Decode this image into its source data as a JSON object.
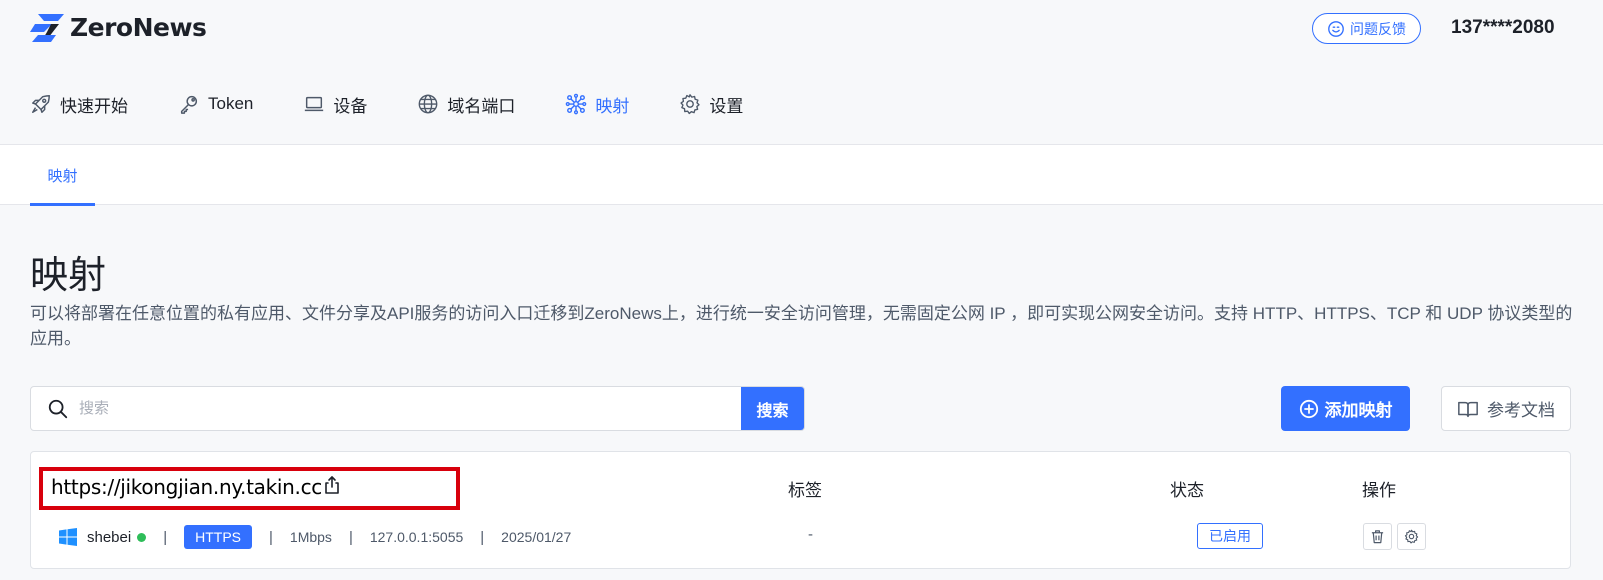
{
  "header": {
    "brand": "ZeroNews",
    "feedback_label": "问题反馈",
    "user_phone": "137****2080"
  },
  "nav": {
    "items": [
      {
        "label": "快速开始",
        "icon": "rocket-icon"
      },
      {
        "label": "Token",
        "icon": "key-icon"
      },
      {
        "label": "设备",
        "icon": "laptop-icon"
      },
      {
        "label": "域名端口",
        "icon": "globe-icon"
      },
      {
        "label": "映射",
        "icon": "network-icon",
        "active": true
      },
      {
        "label": "设置",
        "icon": "gear-icon"
      }
    ]
  },
  "subtabs": [
    {
      "label": "映射",
      "active": true
    }
  ],
  "page": {
    "title": "映射",
    "description": "可以将部署在任意位置的私有应用、文件分享及API服务的访问入口迁移到ZeroNews上，进行统一安全访问管理，无需固定公网 IP ，即可实现公网安全访问。支持 HTTP、HTTPS、TCP 和 UDP 协议类型的应用。"
  },
  "search": {
    "placeholder": "搜索",
    "value": "",
    "button_label": "搜索"
  },
  "actions": {
    "add_label": "添加映射",
    "docs_label": "参考文档"
  },
  "table": {
    "columns": {
      "tags": "标签",
      "status": "状态",
      "actions": "操作"
    },
    "rows": [
      {
        "url": "https://jikongjian.ny.takin.cc",
        "device": "shebei",
        "device_online": true,
        "protocol": "HTTPS",
        "bandwidth": "1Mbps",
        "local_address": "127.0.0.1:5055",
        "date": "2025/01/27",
        "tags": "-",
        "status": "已启用"
      }
    ]
  },
  "colors": {
    "accent": "#3370ff",
    "highlight_border": "#d8000c",
    "online": "#2ebd59"
  }
}
